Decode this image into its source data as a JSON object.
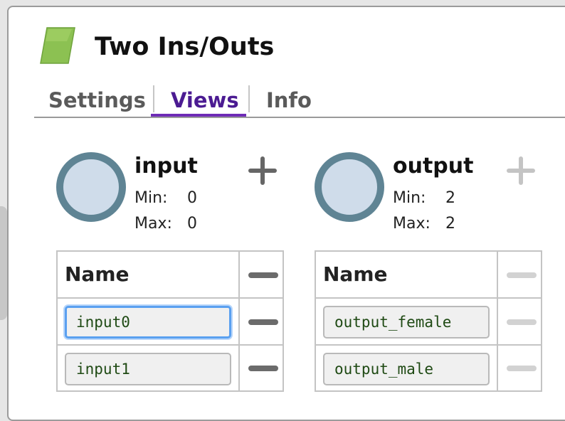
{
  "window": {
    "title": "Two Ins/Outs"
  },
  "header": {
    "icon": "green-parallelogram-icon",
    "icon_color": "#8cc152"
  },
  "tabs": [
    {
      "label": "Settings",
      "active": false
    },
    {
      "label": "Views",
      "active": true
    },
    {
      "label": "Info",
      "active": false
    }
  ],
  "views": {
    "input": {
      "name": "input",
      "min_label": "Min:",
      "min": "0",
      "max_label": "Max:",
      "max": "0",
      "add_enabled": true,
      "column_header": "Name",
      "rows": [
        {
          "value": "input0",
          "focused": true
        },
        {
          "value": "input1",
          "focused": false
        }
      ]
    },
    "output": {
      "name": "output",
      "min_label": "Min:",
      "min": "2",
      "max_label": "Max:",
      "max": "2",
      "add_enabled": false,
      "column_header": "Name",
      "rows": [
        {
          "value": "output_female",
          "focused": false
        },
        {
          "value": "output_male",
          "focused": false
        }
      ]
    }
  },
  "colors": {
    "accent": "#6e2bb6",
    "active_tab_text": "#4b1b92",
    "circle_ring": "#5f8494",
    "circle_fill": "#cfdcea",
    "field_text": "#1f4a14",
    "focus_ring": "#5aa0f0"
  }
}
